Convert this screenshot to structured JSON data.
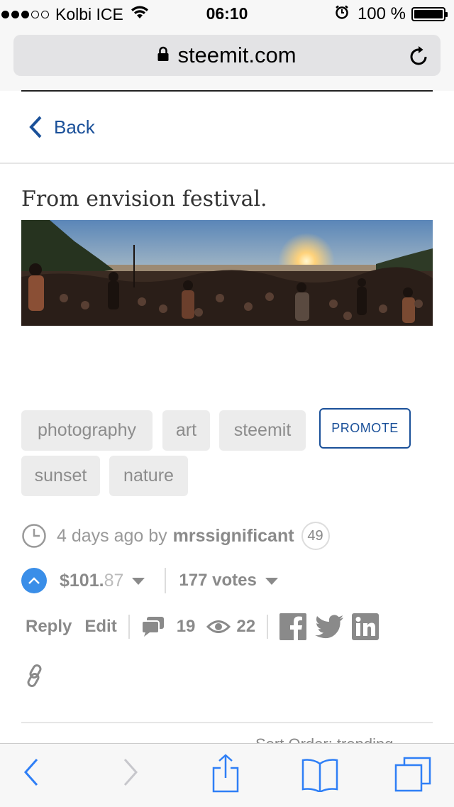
{
  "status_bar": {
    "carrier": "Kolbi ICE",
    "time": "06:10",
    "battery": "100 %"
  },
  "browser": {
    "url": "steemit.com"
  },
  "nav": {
    "back_label": "Back"
  },
  "post": {
    "title": "From envision festival.",
    "image_icon": "panorama-photo",
    "tags": [
      "photography",
      "art",
      "steemit",
      "sunset",
      "nature"
    ],
    "promote_label": "PROMOTE",
    "meta": {
      "time_ago": "4 days ago by",
      "author": "mrssignificant",
      "reputation": "49"
    },
    "payout": {
      "currency": "$",
      "dollars": "101.",
      "cents": "87"
    },
    "votes": "177 votes",
    "actions": {
      "reply": "Reply",
      "edit": "Edit",
      "comments": "19",
      "views": "22"
    },
    "below_fold_text": "Sort Order: trending"
  },
  "colors": {
    "accent": "#1a5099",
    "upvote": "#3a8ee8",
    "tag_bg": "#ececec",
    "muted_text": "#8a8a8a"
  }
}
